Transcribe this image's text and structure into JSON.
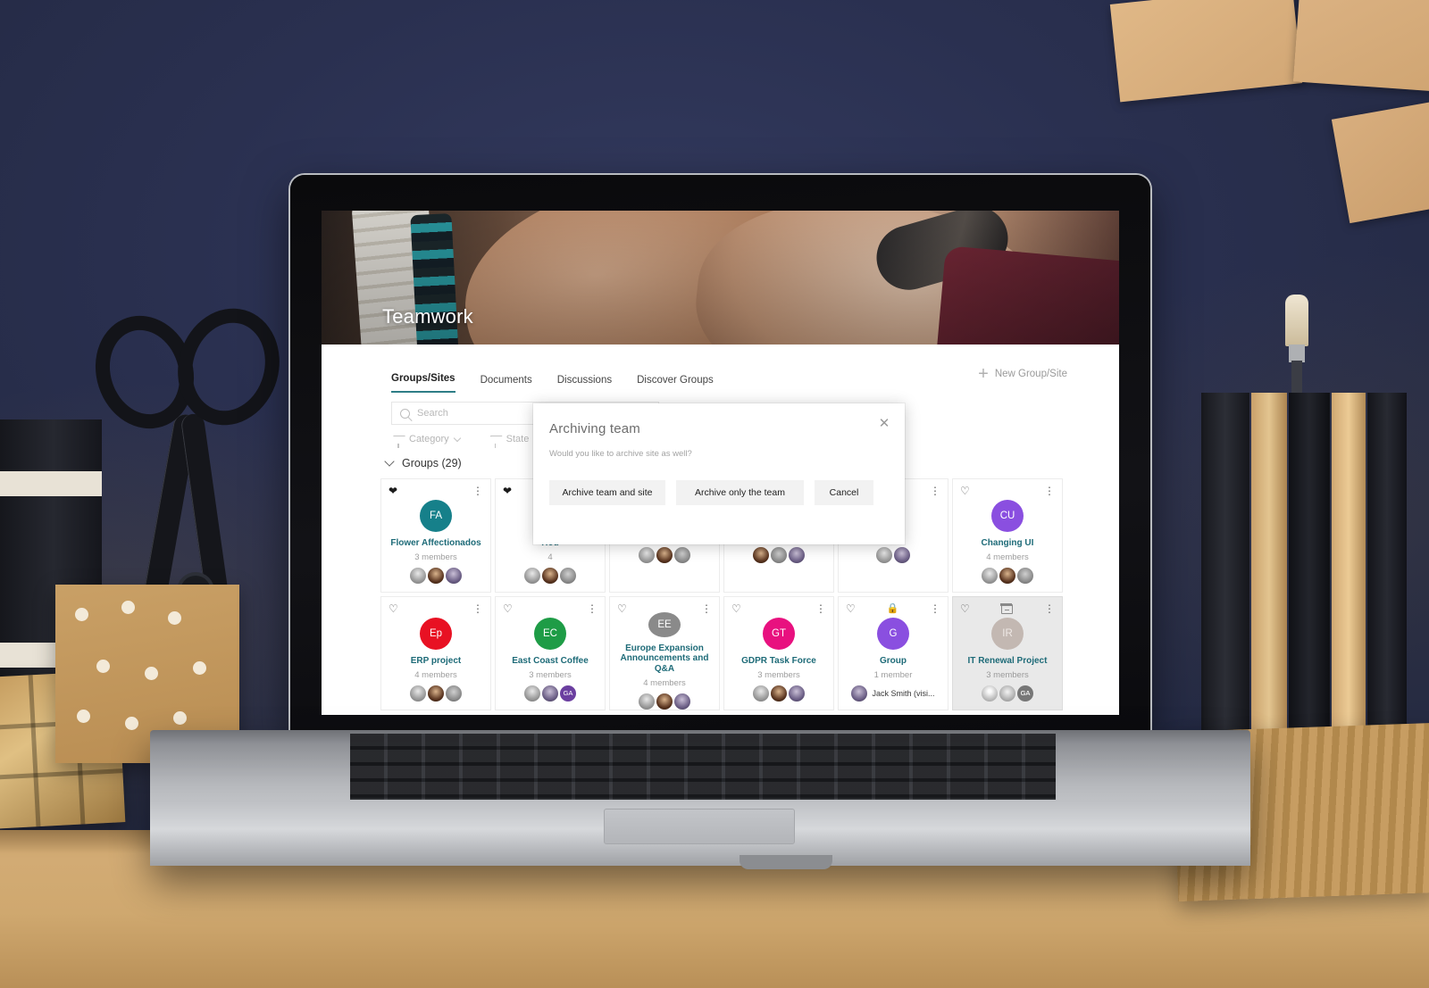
{
  "scene": {
    "description": "laptop on desk against navy wall"
  },
  "site": {
    "banner_title": "Teamwork"
  },
  "nav": {
    "tabs": [
      {
        "label": "Groups/Sites",
        "active": true
      },
      {
        "label": "Documents",
        "active": false
      },
      {
        "label": "Discussions",
        "active": false
      },
      {
        "label": "Discover Groups",
        "active": false
      }
    ],
    "new_group_label": "New Group/Site",
    "new_group_icon": "plus-icon"
  },
  "search": {
    "placeholder": "Search",
    "icon": "search-icon"
  },
  "filters": [
    {
      "label": "Category",
      "icon": "funnel-icon"
    },
    {
      "label": "State",
      "icon": "funnel-icon"
    }
  ],
  "groups_section": {
    "header": "Groups (29)",
    "collapse_icon": "chevron-down-icon"
  },
  "cards": [
    {
      "name": "Flower Affectionados",
      "initials": "FA",
      "color": "#16808a",
      "members": "3 members",
      "favorited": true,
      "status_icon": "",
      "faces": [
        "f1",
        "f2",
        "f4"
      ]
    },
    {
      "name": "Hou",
      "initials": "",
      "color": "#2f7d4f",
      "members": "4",
      "favorited": true,
      "status_icon": "",
      "faces": [
        "f1",
        "f2",
        "f3"
      ]
    },
    {
      "name": "",
      "initials": "",
      "color": "#888888",
      "members": "",
      "favorited": false,
      "status_icon": "",
      "faces": [
        "f1",
        "f2",
        "f3"
      ]
    },
    {
      "name": "",
      "initials": "",
      "color": "#888888",
      "members": "",
      "favorited": false,
      "status_icon": "",
      "faces": [
        "f2",
        "f3",
        "f4"
      ]
    },
    {
      "name": "",
      "initials": "",
      "color": "#888888",
      "members": "",
      "favorited": false,
      "status_icon": "",
      "faces": [
        "f1",
        "f4"
      ]
    },
    {
      "name": "Changing UI",
      "initials": "CU",
      "color": "#8a4fe0",
      "members": "4 members",
      "favorited": false,
      "status_icon": "",
      "faces": [
        "f1",
        "f2",
        "f3"
      ]
    },
    {
      "name": "ERP project",
      "initials": "Ep",
      "color": "#e81123",
      "members": "4 members",
      "favorited": false,
      "status_icon": "",
      "faces": [
        "f1",
        "f2",
        "f3"
      ]
    },
    {
      "name": "East Coast Coffee",
      "initials": "EC",
      "color": "#1e9c46",
      "members": "3 members",
      "favorited": false,
      "status_icon": "",
      "faces": [
        "f1",
        "f4",
        "ga"
      ]
    },
    {
      "name": "Europe Expansion Announcements and Q&A",
      "initials": "EE",
      "color": "#8a8a8a",
      "members": "4 members",
      "favorited": false,
      "status_icon": "",
      "faces": [
        "f1",
        "f2",
        "f4"
      ]
    },
    {
      "name": "GDPR Task Force",
      "initials": "GT",
      "color": "#e8117f",
      "members": "3 members",
      "favorited": false,
      "status_icon": "",
      "faces": [
        "f1",
        "f2",
        "f4"
      ]
    },
    {
      "name": "Group",
      "initials": "G",
      "color": "#8a4fe0",
      "members": "1 member",
      "favorited": false,
      "status_icon": "lock-icon",
      "single_member_name": "Jack Smith (visi...",
      "faces": []
    },
    {
      "name": "IT Renewal Project",
      "initials": "IR",
      "color": "#c3b8b2",
      "members": "3 members",
      "favorited": false,
      "status_icon": "archive-icon",
      "archived": true,
      "faces": [
        "f1",
        "f3",
        "ga"
      ]
    }
  ],
  "dialog": {
    "title": "Archiving team",
    "message": "Would you like to archive site as well?",
    "close_icon": "close-icon",
    "buttons": [
      {
        "label": "Archive team and site"
      },
      {
        "label": "Archive only the team"
      },
      {
        "label": "Cancel"
      }
    ]
  },
  "theme": {
    "accent": "#2e7d86",
    "link": "#1e6b78",
    "wall": "#2a3050",
    "desk": "#cfa86f"
  },
  "facepile_initials": {
    "ga": "GA"
  }
}
